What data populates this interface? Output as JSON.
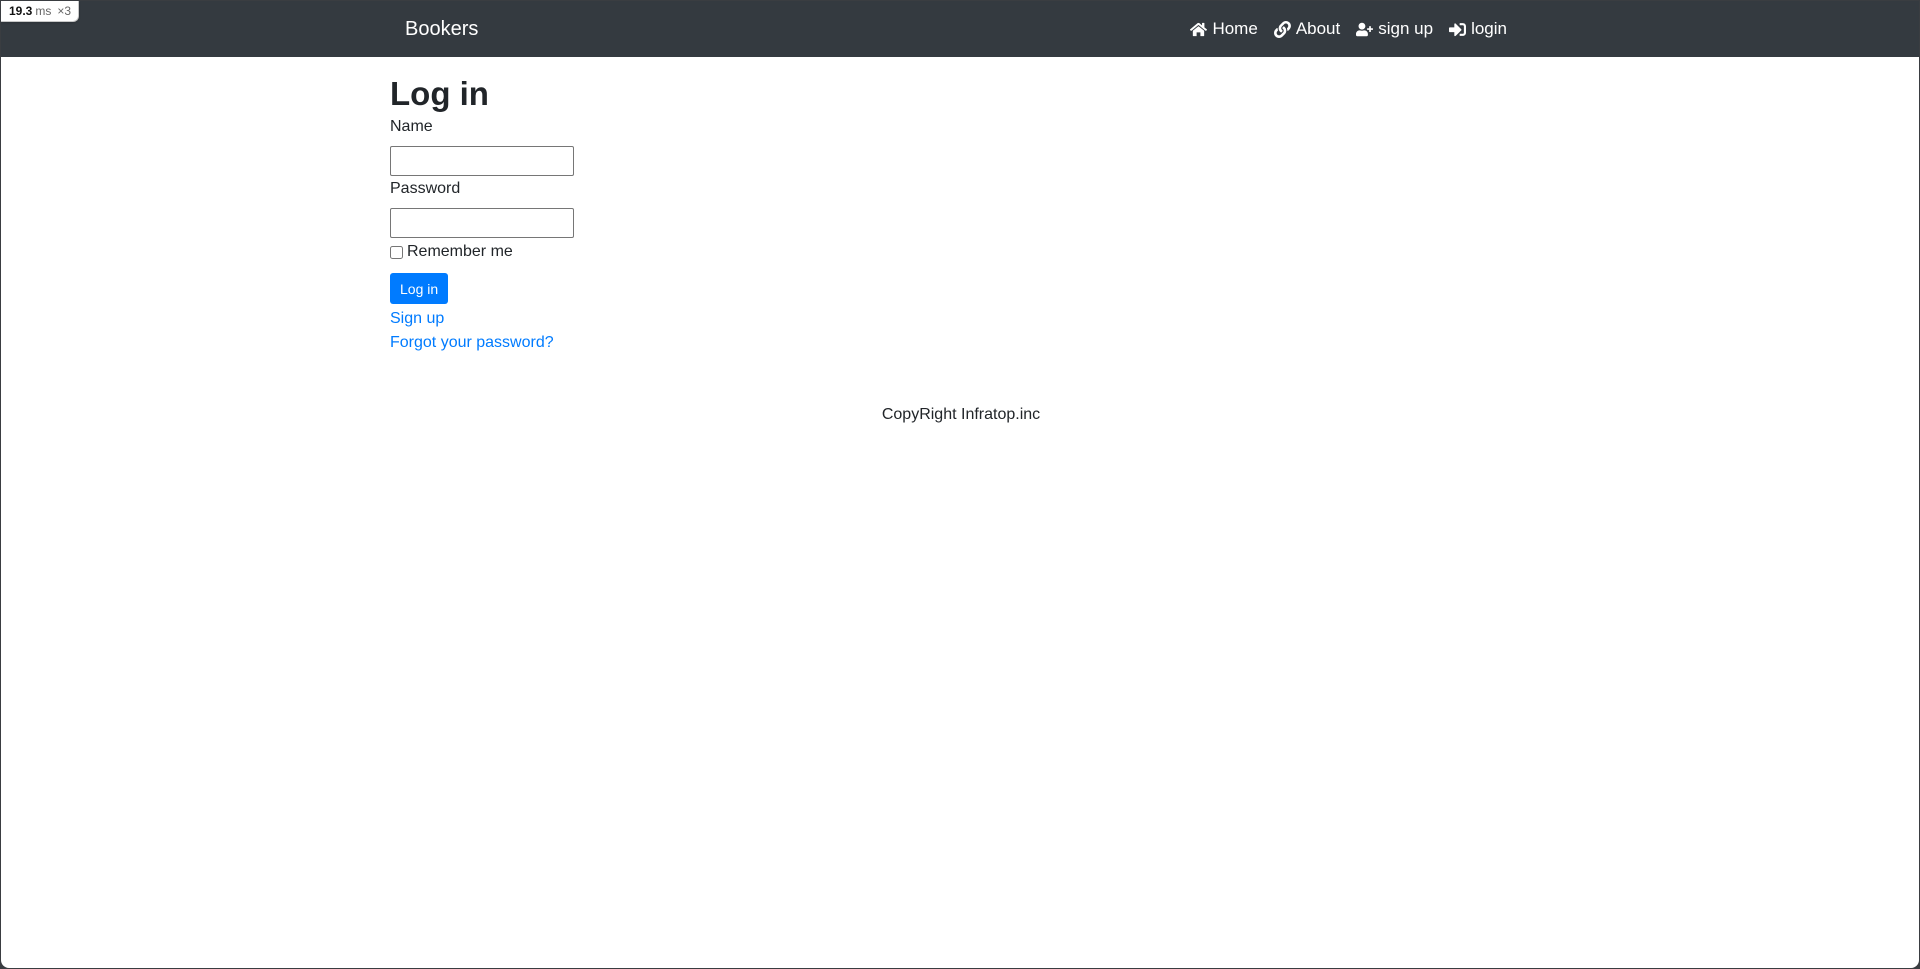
{
  "perf_badge": {
    "value": "19.3",
    "unit": "ms",
    "multiplier": "×3"
  },
  "navbar": {
    "brand": "Bookers",
    "links": [
      {
        "label": "Home",
        "icon": "home-icon"
      },
      {
        "label": "About",
        "icon": "link-icon"
      },
      {
        "label": "sign up",
        "icon": "user-plus-icon"
      },
      {
        "label": "login",
        "icon": "sign-in-icon"
      }
    ],
    "background_color": "#343a40"
  },
  "main": {
    "title": "Log in",
    "name_label": "Name",
    "name_value": "",
    "password_label": "Password",
    "password_value": "",
    "remember_label": "Remember me",
    "remember_checked": false,
    "submit_label": "Log in",
    "signup_link": "Sign up",
    "forgot_link": "Forgot your password?"
  },
  "footer": {
    "text": "CopyRight Infratop.inc"
  },
  "colors": {
    "accent": "#007bff",
    "text": "#212529"
  }
}
